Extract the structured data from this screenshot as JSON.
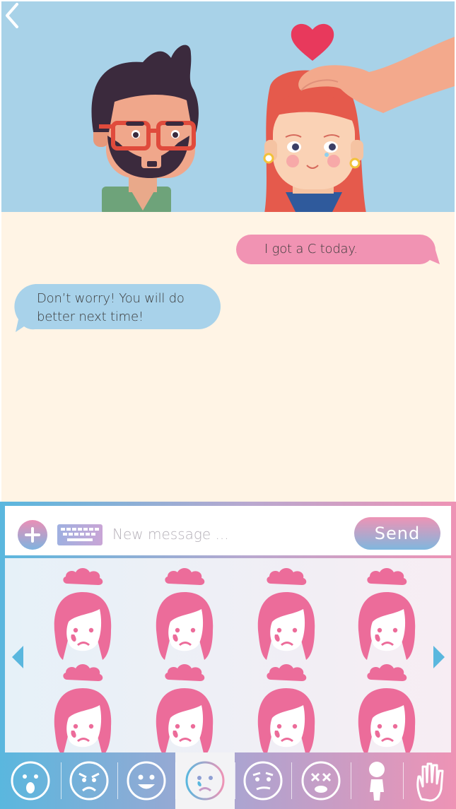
{
  "header": {
    "back_icon": "chevron-left-icon"
  },
  "hero": {
    "illustration": "dad-comforting-daughter",
    "icons": [
      "heart-icon",
      "hand-icon"
    ]
  },
  "conversation": {
    "messages": [
      {
        "direction": "outgoing",
        "text": "I got a C today.",
        "color": "#f193b3"
      },
      {
        "direction": "incoming",
        "line1": "Don’t worry! You will do",
        "line2": "better next time!",
        "color": "#a8d2ea"
      }
    ]
  },
  "composer": {
    "add_icon": "plus-icon",
    "keyboard_icon": "keyboard-icon",
    "placeholder": "New message ...",
    "send_label": "Send"
  },
  "stickers": {
    "sticker_icon": "sad-girl-raincloud-sticker",
    "count": 8,
    "prev_icon": "triangle-left-icon",
    "next_icon": "triangle-right-icon",
    "sticker_color": "#ec6c9a"
  },
  "categories": {
    "selected": "sad",
    "items": [
      "surprised",
      "angry",
      "happy",
      "sad",
      "worried",
      "dizzy",
      "body",
      "hand"
    ]
  },
  "colors": {
    "accent_blue": "#5ab7de",
    "accent_pink": "#ee93b5",
    "chat_bg": "#fff4e5",
    "hero_bg": "#a8d2e8"
  }
}
